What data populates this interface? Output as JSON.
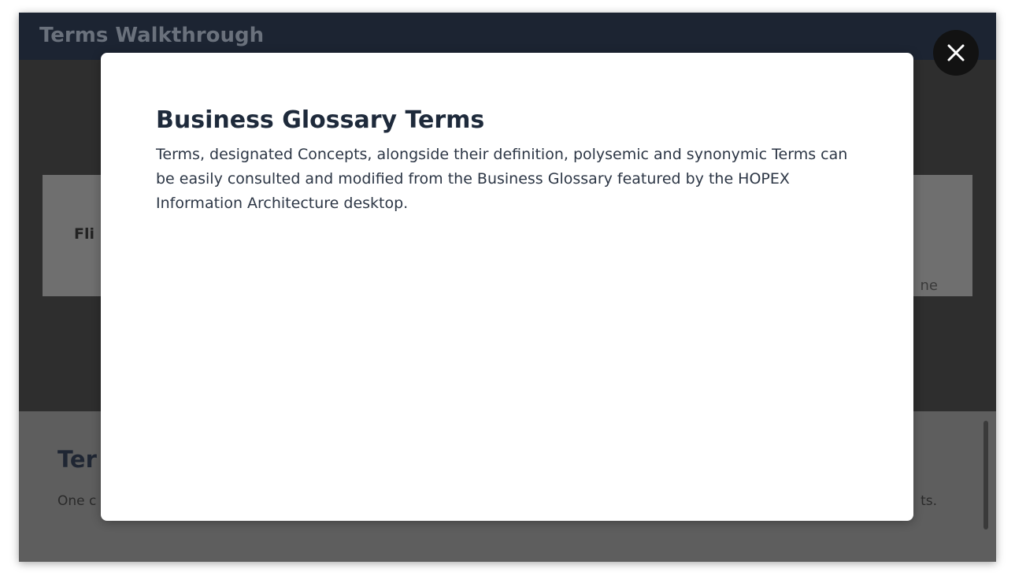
{
  "window": {
    "title": "Terms Walkthrough"
  },
  "background": {
    "card_title": "Fli",
    "card_tail": "ne",
    "section_title": "Ter",
    "section_text": "One c",
    "section_tail": "ts."
  },
  "modal": {
    "title": "Business Glossary Terms",
    "body": "Terms, designated Concepts, alongside their definition, polysemic and synonymic Terms can be easily consulted and modified from the Business Glossary featured by the HOPEX Information Architecture desktop."
  },
  "close_button": {
    "icon": "close-icon"
  },
  "colors": {
    "titlebar": "#1c2432",
    "modal_title": "#1e2a3b",
    "close_button": "#121212"
  }
}
